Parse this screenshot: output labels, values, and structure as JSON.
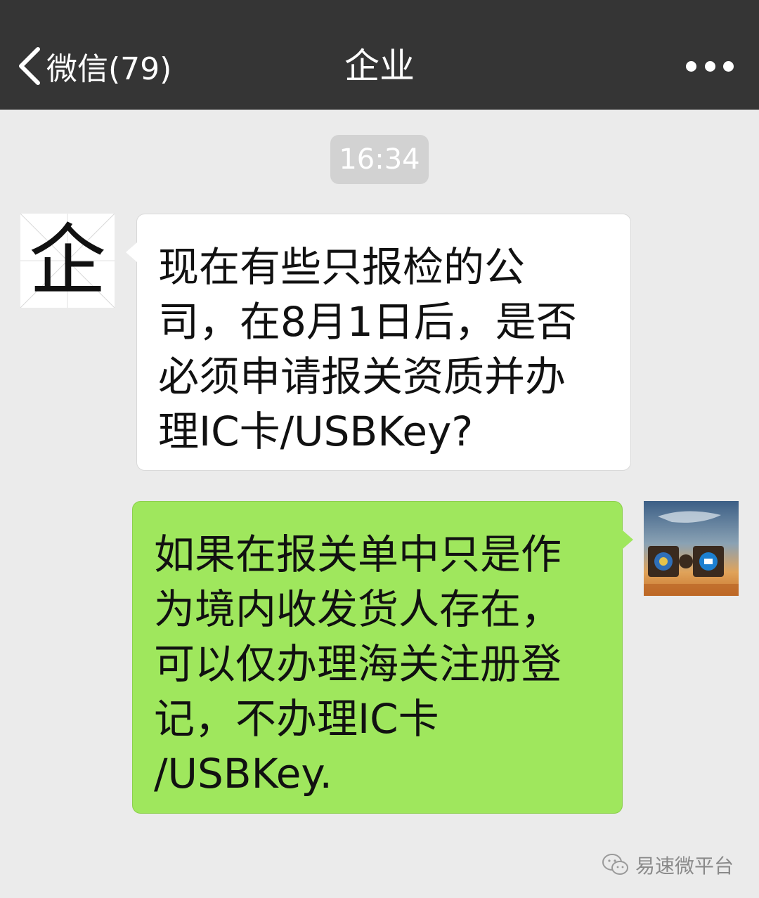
{
  "nav": {
    "back_label": "微信(79)",
    "title": "企业",
    "more_icon": "more-dots-icon"
  },
  "timestamp": "16:34",
  "messages": [
    {
      "side": "left",
      "sender_avatar_glyph": "企",
      "lines": [
        "现在有些只报检的公",
        "司，在8月1日后，是否",
        "必须申请报关资质并办",
        "理IC卡/USBKey?"
      ]
    },
    {
      "side": "right",
      "lines": [
        "如果在报关单中只是作",
        "为境内收发货人存在，",
        "可以仅办理海关注册登",
        "记，不办理IC卡",
        "/USBKey."
      ]
    }
  ],
  "watermark": "易速微平台",
  "colors": {
    "nav_bg": "#353535",
    "chat_bg": "#ebebeb",
    "bubble_left": "#ffffff",
    "bubble_right": "#9fe75d"
  }
}
